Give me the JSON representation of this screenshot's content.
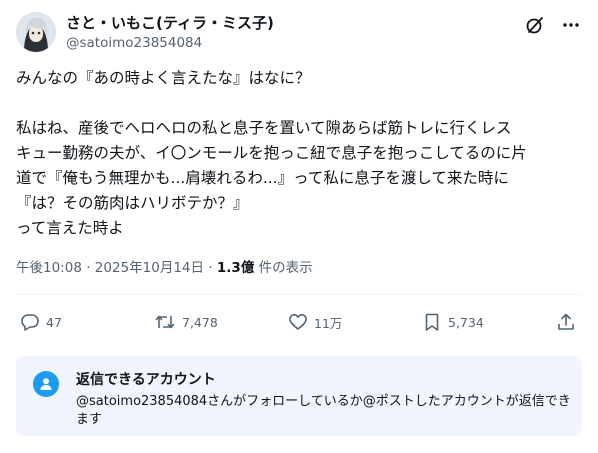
{
  "author": {
    "display_name": "さと・いもこ(ティラ・ミス子)",
    "handle": "@satoimo23854084"
  },
  "header_icons": [
    "grok-icon",
    "more-icon"
  ],
  "post": {
    "lines": [
      "みんなの『あの時よく言えたな』はなに？",
      "",
      "私はね、産後でヘロヘロの私と息子を置いて隙あらば筋トレに行くレス",
      "キュー勤務の夫が、イ〇ンモールを抱っこ紐で息子を抱っこしてるのに片",
      "道で『俺もう無理かも...肩壊れるわ...』って私に息子を渡して来た時に",
      "『は？その筋肉はハリボテか？』",
      "って言えた時よ"
    ]
  },
  "meta": {
    "time": "午後10:08",
    "separator": "·",
    "date": "2025年10月14日",
    "views_count": "1.3億",
    "views_label": "件の表示"
  },
  "actions": {
    "replies": "47",
    "reposts": "7,478",
    "likes": "11万",
    "bookmarks": "5,734"
  },
  "reply_restriction": {
    "title": "返信できるアカウント",
    "description": "@satoimo23854084さんがフォローしているか@ポストしたアカウントが返信できます"
  },
  "colors": {
    "text": "#0f1419",
    "secondary": "#536471",
    "accent": "#1d9bf0",
    "panel": "#f0f6fb"
  }
}
